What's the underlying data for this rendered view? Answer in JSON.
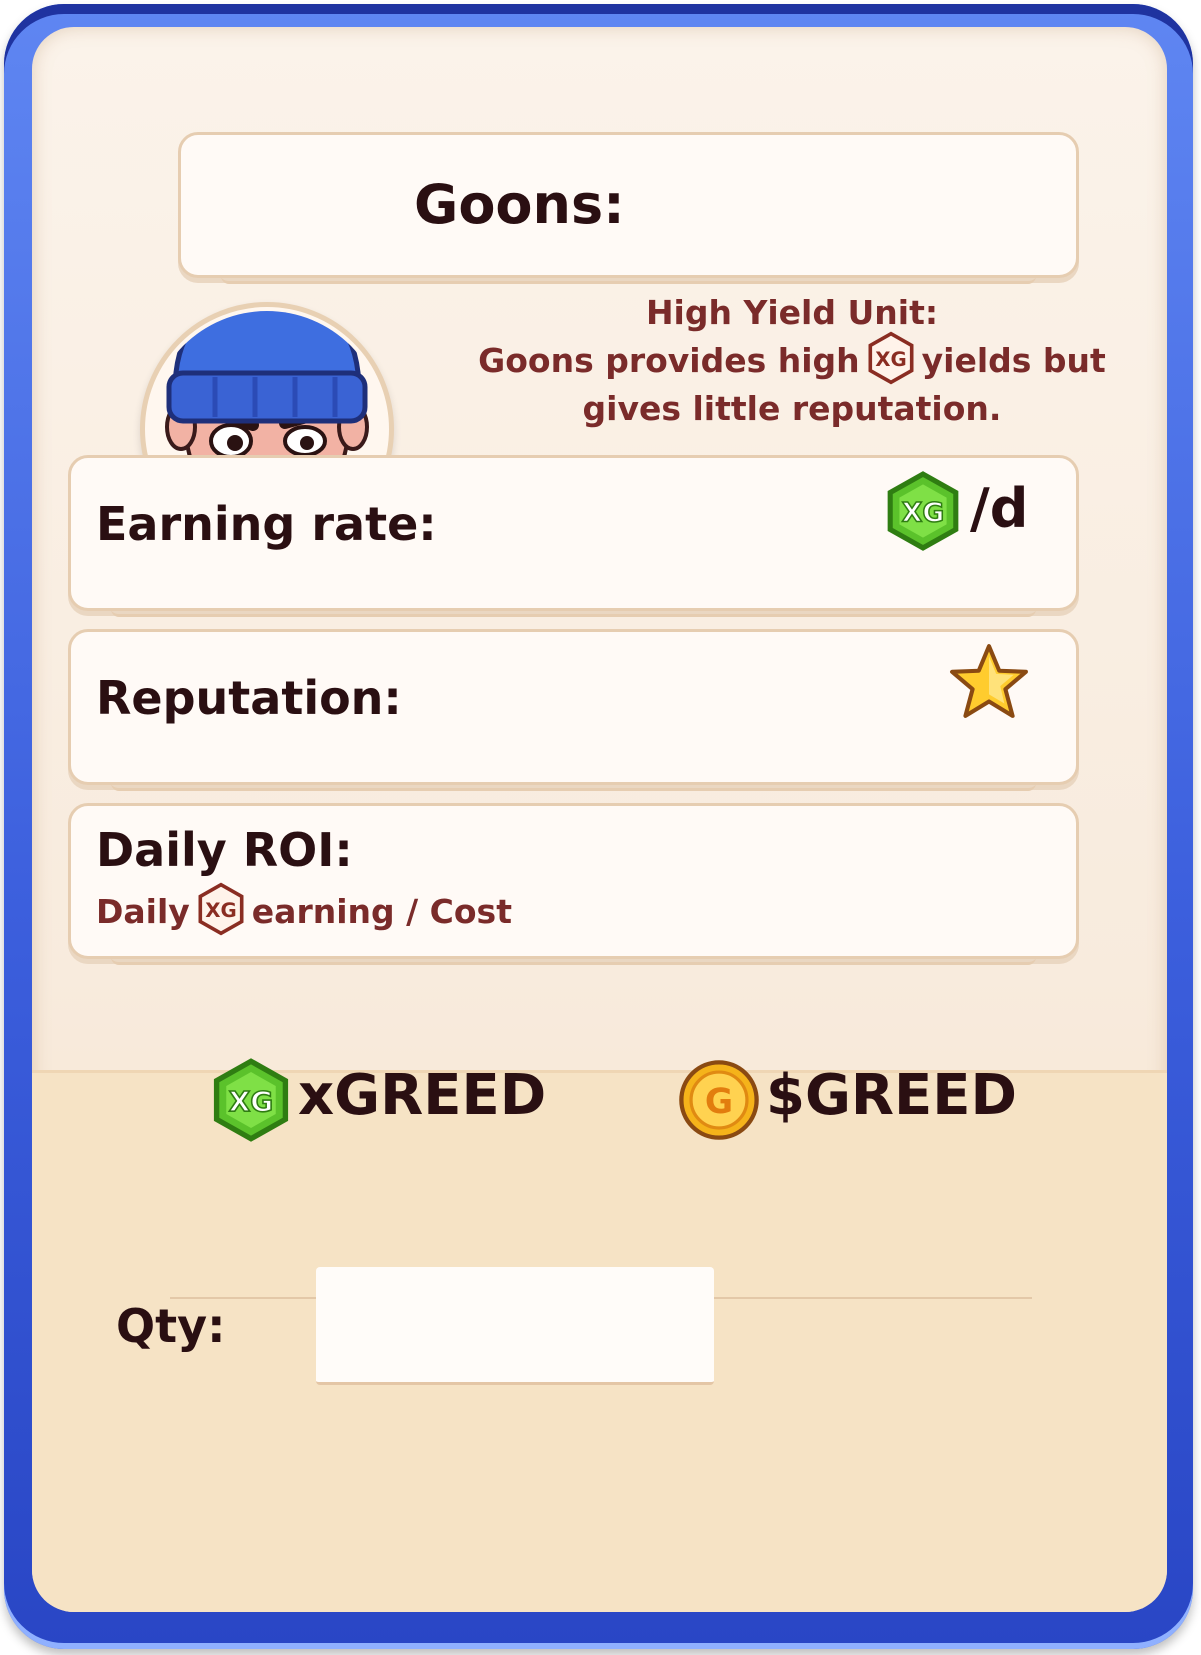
{
  "unit": {
    "title": "Goons:",
    "subtitle": "High Yield Unit:",
    "desc_part1": "Goons provides high",
    "desc_part2": "yields but",
    "desc_line2": "gives little reputation."
  },
  "stats": {
    "earning_label": "Earning rate:",
    "earning_suffix": "/d",
    "reputation_label": "Reputation:",
    "roi_label": "Daily ROI:",
    "roi_sub_part1": "Daily",
    "roi_sub_part2": "earning / Cost"
  },
  "currencies": {
    "xgreed": "xGREED",
    "greed": "$GREED"
  },
  "qty": {
    "label": "Qty:",
    "value": ""
  },
  "colors": {
    "frame": "#3c5fdd",
    "panel": "#fbf3ea",
    "text_dark": "#2a0f12",
    "text_accent": "#7a2b2a",
    "xg_green": "#5bc22b",
    "coin_gold": "#f5b31a",
    "star": "#ffcc2e"
  }
}
